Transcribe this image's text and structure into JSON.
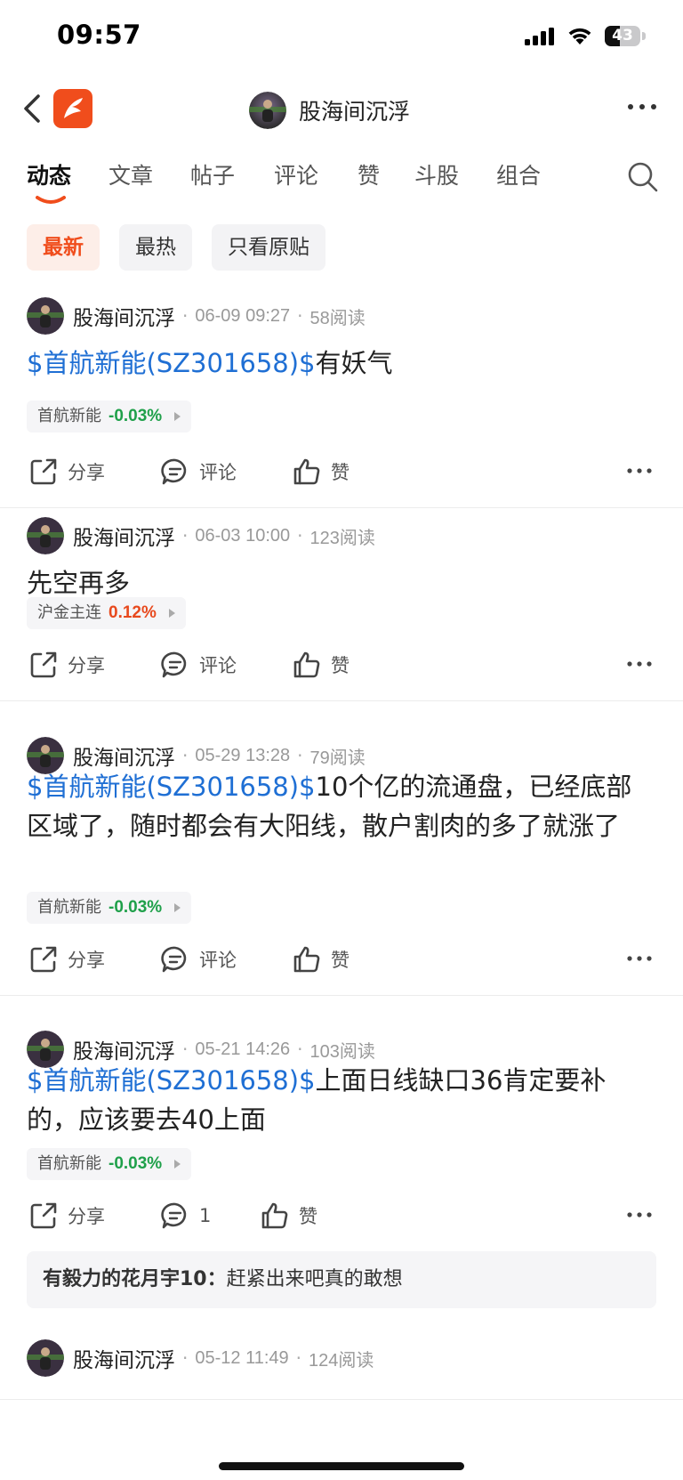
{
  "status": {
    "time": "09:57",
    "battery": "43",
    "battery_level_percent": 43
  },
  "header": {
    "title": "股海间沉浮"
  },
  "tabs": [
    "动态",
    "文章",
    "帖子",
    "评论",
    "赞",
    "斗股",
    "组合"
  ],
  "filters": [
    "最新",
    "最热",
    "只看原贴"
  ],
  "actions": {
    "share": "分享",
    "comment": "评论",
    "like": "赞"
  },
  "posts": [
    {
      "author": "股海间沉浮",
      "time": "06-09 09:27",
      "reads": "58阅读",
      "ticker": "$首航新能(SZ301658)$",
      "text": "有妖气",
      "stock": {
        "name": "首航新能",
        "change": "-0.03%"
      }
    },
    {
      "author": "股海间沉浮",
      "time": "06-03 10:00",
      "reads": "123阅读",
      "ticker": "",
      "text": "先空再多",
      "stock": {
        "name": "沪金主连",
        "change": "0.12%"
      }
    },
    {
      "author": "股海间沉浮",
      "time": "05-29 13:28",
      "reads": "79阅读",
      "ticker": "$首航新能(SZ301658)$",
      "text": "10个亿的流通盘，已经底部区域了，随时都会有大阳线，散户割肉的多了就涨了",
      "stock": {
        "name": "首航新能",
        "change": "-0.03%"
      }
    },
    {
      "author": "股海间沉浮",
      "time": "05-21 14:26",
      "reads": "103阅读",
      "ticker": "$首航新能(SZ301658)$",
      "text": "上面日线缺口36肯定要补的，应该要去40上面",
      "stock": {
        "name": "首航新能",
        "change": "-0.03%"
      },
      "comment_count": "1",
      "comment_preview": {
        "author": "有毅力的花月宇10：",
        "text": "赶紧出来吧真的敢想"
      }
    },
    {
      "author": "股海间沉浮",
      "time": "05-12 11:49",
      "reads": "124阅读"
    }
  ],
  "colors": {
    "accent": "#f04d1c",
    "ticker": "#1f6fd4",
    "down": "#1fa04a",
    "up": "#e8491d"
  }
}
